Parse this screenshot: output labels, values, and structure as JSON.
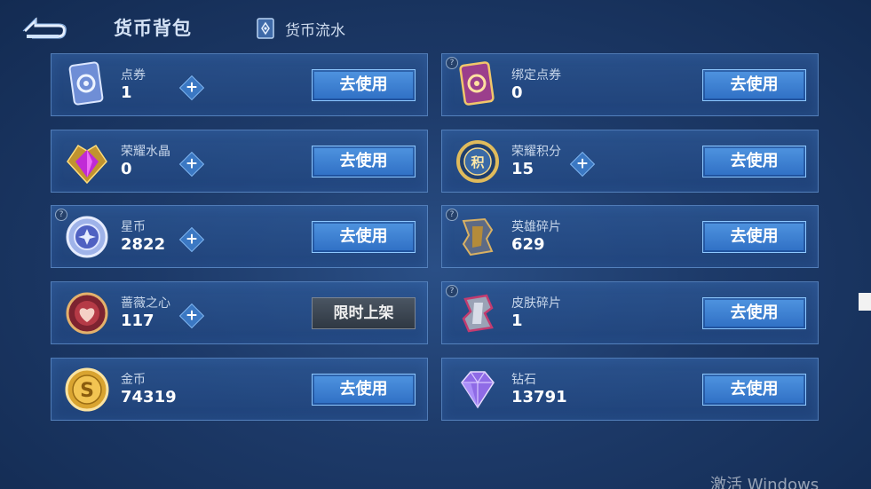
{
  "header": {
    "title": "货币背包",
    "flow_tab_label": "货币流水"
  },
  "cards": [
    {
      "name": "点券",
      "value": "1",
      "has_plus": true,
      "help": false,
      "action": "去使用",
      "action_type": "use",
      "icon": "coupon-icon"
    },
    {
      "name": "绑定点券",
      "value": "0",
      "has_plus": false,
      "help": true,
      "action": "去使用",
      "action_type": "use",
      "icon": "bound-coupon-icon"
    },
    {
      "name": "荣耀水晶",
      "value": "0",
      "has_plus": true,
      "help": false,
      "action": "去使用",
      "action_type": "use",
      "icon": "glory-crystal-icon"
    },
    {
      "name": "荣耀积分",
      "value": "15",
      "has_plus": true,
      "help": false,
      "action": "去使用",
      "action_type": "use",
      "icon": "glory-points-icon"
    },
    {
      "name": "星币",
      "value": "2822",
      "has_plus": true,
      "help": true,
      "action": "去使用",
      "action_type": "use",
      "icon": "star-coin-icon"
    },
    {
      "name": "英雄碎片",
      "value": "629",
      "has_plus": false,
      "help": true,
      "action": "去使用",
      "action_type": "use",
      "icon": "hero-fragment-icon"
    },
    {
      "name": "蔷薇之心",
      "value": "117",
      "has_plus": true,
      "help": false,
      "action": "限时上架",
      "action_type": "limited",
      "icon": "rose-heart-icon"
    },
    {
      "name": "皮肤碎片",
      "value": "1",
      "has_plus": false,
      "help": true,
      "action": "去使用",
      "action_type": "use",
      "icon": "skin-fragment-icon"
    },
    {
      "name": "金币",
      "value": "74319",
      "has_plus": false,
      "help": false,
      "action": "去使用",
      "action_type": "use",
      "icon": "gold-coin-icon"
    },
    {
      "name": "钻石",
      "value": "13791",
      "has_plus": false,
      "help": false,
      "action": "去使用",
      "action_type": "use",
      "icon": "diamond-icon"
    }
  ],
  "help_mark": "?",
  "plus_symbol": "+",
  "watermark": "激活 Windows"
}
